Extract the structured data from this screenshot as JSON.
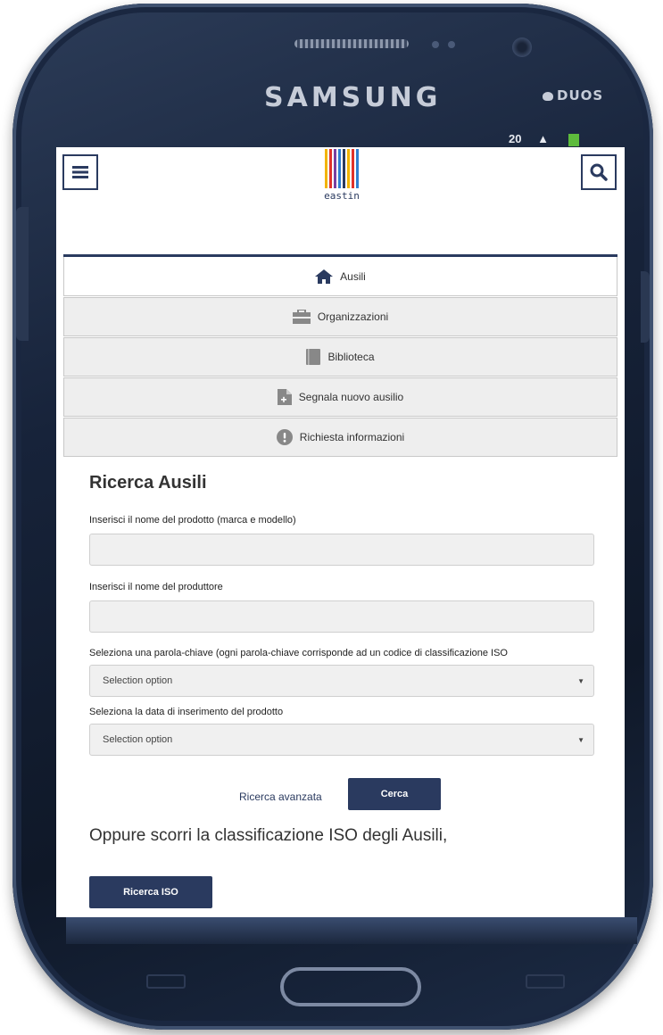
{
  "device": {
    "brand": "SAMSUNG",
    "model_badge": "DUOS",
    "status_time": "20"
  },
  "header": {
    "menu_icon": "hamburger-icon",
    "search_icon": "search-icon",
    "logo_text": "eastin",
    "logo_colors": [
      "#f2b400",
      "#e0322b",
      "#7a3fa0",
      "#2f7fd1",
      "#2a3a5f",
      "#f2b400",
      "#e0322b",
      "#2f7fd1"
    ]
  },
  "nav": {
    "items": [
      {
        "label": "Ausili",
        "icon": "home-icon",
        "active": true
      },
      {
        "label": "Organizzazioni",
        "icon": "briefcase-icon",
        "active": false
      },
      {
        "label": "Biblioteca",
        "icon": "book-icon",
        "active": false
      },
      {
        "label": "Segnala nuovo ausilio",
        "icon": "new-document-icon",
        "active": false
      },
      {
        "label": "Richiesta informazioni",
        "icon": "exclamation-circle-icon",
        "active": false
      }
    ]
  },
  "search_form": {
    "title": "Ricerca Ausili",
    "product_name_label": "Inserisci il nome del prodotto (marca e modello)",
    "product_name_value": "",
    "manufacturer_label": "Inserisci il nome del produttore",
    "manufacturer_value": "",
    "keyword_label": "Seleziona una parola-chiave (ogni parola-chiave corrisponde ad un codice di classificazione ISO",
    "keyword_selected": "Selection option",
    "date_label": "Seleziona la data di inserimento del prodotto",
    "date_selected": "Selection option",
    "advanced_link": "Ricerca avanzata",
    "search_button": "Cerca"
  },
  "iso": {
    "text": "Oppure scorri la classificazione ISO degli Ausili,",
    "button": "Ricerca ISO"
  },
  "colors": {
    "primary": "#2a3a5f",
    "nav_inactive_bg": "#eeeeee",
    "input_bg": "#f0f0f0"
  }
}
